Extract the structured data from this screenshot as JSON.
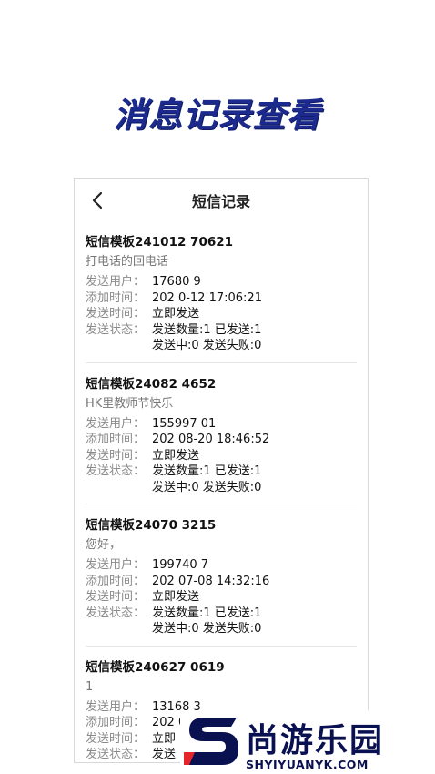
{
  "hero": {
    "title": "消息记录查看"
  },
  "nav": {
    "title": "短信记录"
  },
  "labels": {
    "sender": "发送用户：",
    "added": "添加时间：",
    "send_time": "发送时间：",
    "status": "发送状态："
  },
  "records": [
    {
      "title": "短信模板241012 70621",
      "content": "打电话的回电话",
      "sender": "17680 9",
      "added": "202 0-12 17:06:21",
      "send_time": "立即发送",
      "status_line1": "发送数量:1  已发送:1",
      "status_line2": "发送中:0  发送失败:0"
    },
    {
      "title": "短信模板24082 4652",
      "content": "HK里教师节快乐",
      "sender": "155997 01",
      "added": "202 08-20 18:46:52",
      "send_time": "立即发送",
      "status_line1": "发送数量:1  已发送:1",
      "status_line2": "发送中:0  发送失败:0"
    },
    {
      "title": "短信模板24070 3215",
      "content": "您好，",
      "sender": "199740 7",
      "added": "202 07-08 14:32:16",
      "send_time": "立即发送",
      "status_line1": "发送数量:1  已发送:1",
      "status_line2": "发送中:0  发送失败:0"
    },
    {
      "title": "短信模板240627 0619",
      "content": "1",
      "sender": "13168 3",
      "added": "202 06-27 09:06:20",
      "send_time": "立即",
      "status_line1": "发送",
      "status_line2": ""
    }
  ],
  "watermark": {
    "cn": "尚游乐园",
    "en": "SHYIYUANYK.COM"
  },
  "colors": {
    "hero": "#1b2a8c",
    "watermark": "#0a1150",
    "accent_red": "#e6252b"
  }
}
